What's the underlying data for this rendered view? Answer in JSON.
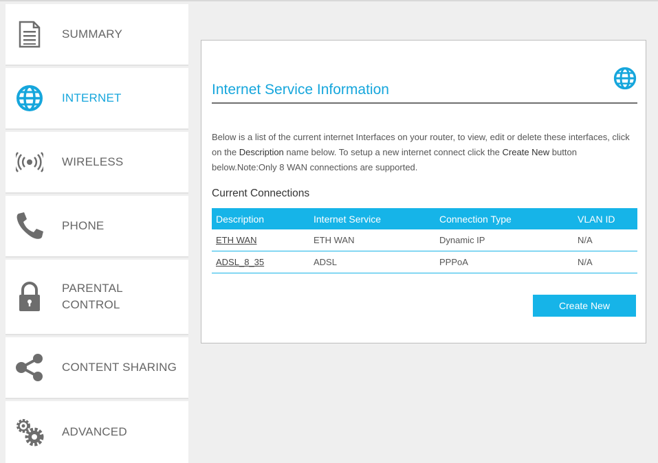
{
  "sidebar": {
    "items": [
      {
        "label": "SUMMARY",
        "icon": "document-icon"
      },
      {
        "label": "INTERNET",
        "icon": "globe-icon",
        "active": true
      },
      {
        "label": "WIRELESS",
        "icon": "wireless-icon"
      },
      {
        "label": "PHONE",
        "icon": "phone-icon"
      },
      {
        "label": "PARENTAL",
        "label2": "CONTROL",
        "icon": "lock-icon"
      },
      {
        "label": "CONTENT SHARING",
        "icon": "share-icon"
      },
      {
        "label": "ADVANCED",
        "icon": "gears-icon"
      }
    ]
  },
  "panel": {
    "title": "Internet Service Information",
    "intro_1": "Below is a list of the current internet Interfaces on your router, to view, edit or delete these interfaces, click on the ",
    "intro_desc": "Description",
    "intro_2": " name below. To setup a new internet connect click the ",
    "intro_create": "Create New",
    "intro_3": " button below.Note:Only 8 WAN connections are supported.",
    "section_title": "Current Connections",
    "columns": [
      "Description",
      "Internet Service",
      "Connection Type",
      "VLAN ID"
    ],
    "rows": [
      {
        "description": "ETH WAN",
        "service": "ETH WAN",
        "type": "Dynamic IP",
        "vlan": "N/A"
      },
      {
        "description": "ADSL_8_35",
        "service": "ADSL",
        "type": "PPPoA",
        "vlan": "N/A"
      }
    ],
    "create_button": "Create New"
  },
  "colors": {
    "accent": "#16b4e8",
    "title": "#16a6dc",
    "background": "#efefef"
  }
}
